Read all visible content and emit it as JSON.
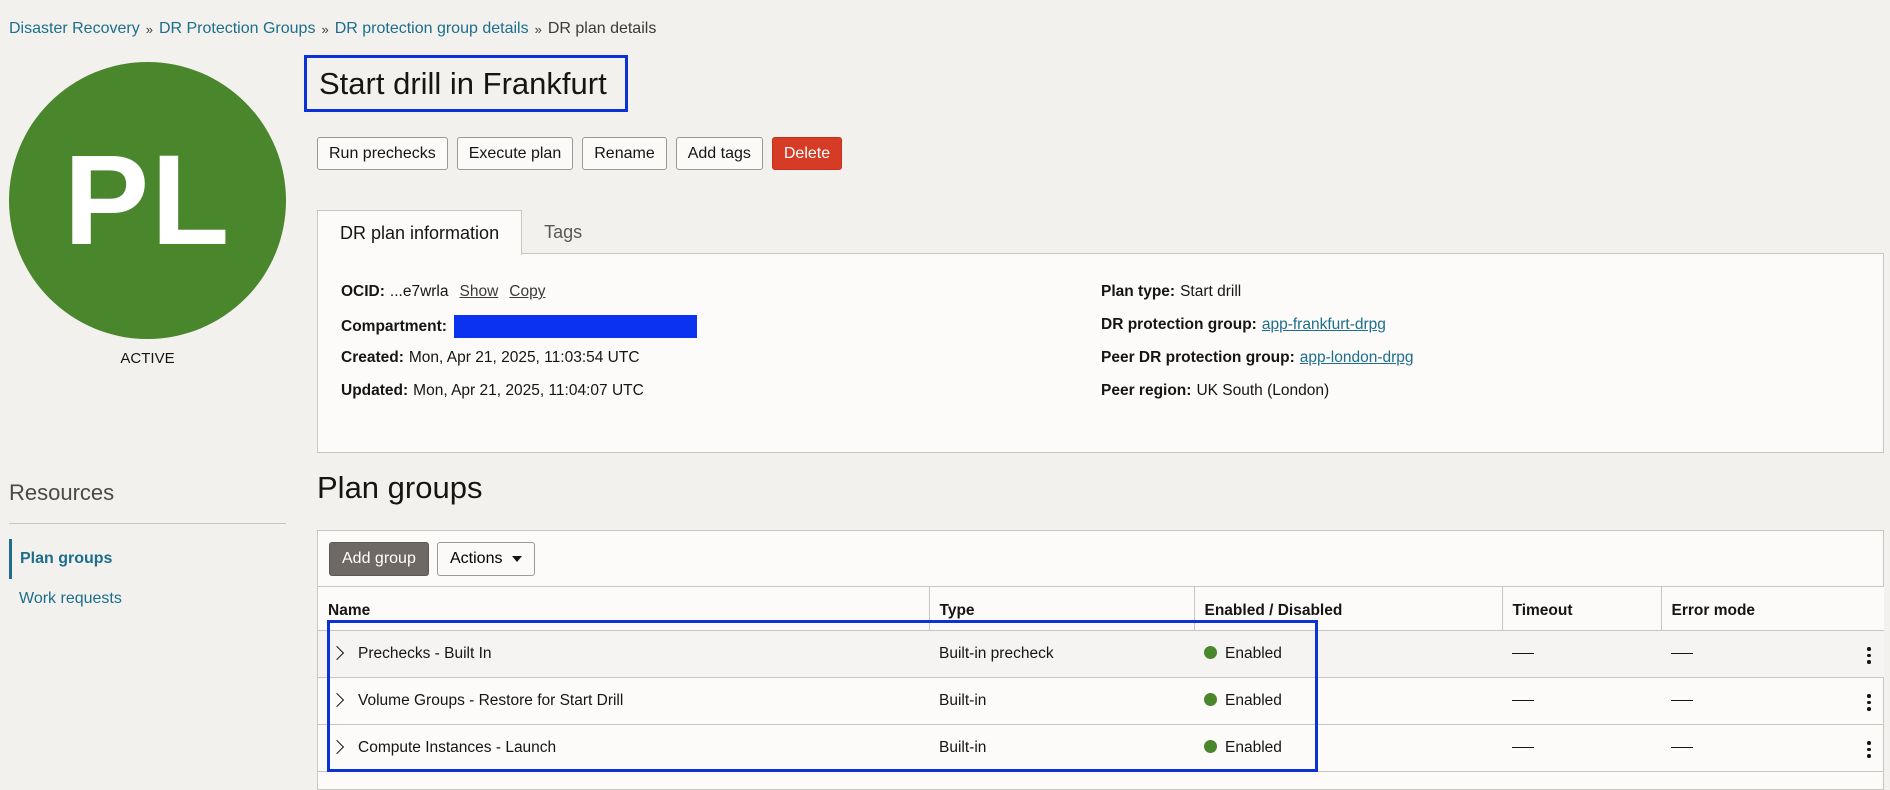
{
  "breadcrumb": {
    "items": [
      "Disaster Recovery",
      "DR Protection Groups",
      "DR protection group details"
    ],
    "current": "DR plan details",
    "separator": "»"
  },
  "avatar": {
    "initials": "PL",
    "status": "ACTIVE",
    "color": "#4a862b"
  },
  "page": {
    "title": "Start drill in Frankfurt"
  },
  "actions": {
    "run_prechecks": "Run prechecks",
    "execute_plan": "Execute plan",
    "rename": "Rename",
    "add_tags": "Add tags",
    "delete": "Delete"
  },
  "tabs": [
    {
      "label": "DR plan information",
      "active": true
    },
    {
      "label": "Tags",
      "active": false
    }
  ],
  "info": {
    "ocid_label": "OCID:",
    "ocid_value": "...e7wrla",
    "ocid_show": "Show",
    "ocid_copy": "Copy",
    "compartment_label": "Compartment:",
    "created_label": "Created:",
    "created_value": "Mon, Apr 21, 2025, 11:03:54 UTC",
    "updated_label": "Updated:",
    "updated_value": "Mon, Apr 21, 2025, 11:04:07 UTC",
    "plan_type_label": "Plan type:",
    "plan_type_value": "Start drill",
    "drpg_label": "DR protection group:",
    "drpg_value": "app-frankfurt-drpg",
    "peer_drpg_label": "Peer DR protection group:",
    "peer_drpg_value": "app-london-drpg",
    "peer_region_label": "Peer region:",
    "peer_region_value": "UK South (London)"
  },
  "resources": {
    "heading": "Resources",
    "items": [
      {
        "label": "Plan groups",
        "active": true
      },
      {
        "label": "Work requests",
        "active": false
      }
    ]
  },
  "plan_groups": {
    "heading": "Plan groups",
    "add_group": "Add group",
    "actions": "Actions",
    "columns": [
      "Name",
      "Type",
      "Enabled / Disabled",
      "Timeout",
      "Error mode"
    ],
    "rows": [
      {
        "name": "Prechecks - Built In",
        "type": "Built-in precheck",
        "status": "Enabled"
      },
      {
        "name": "Volume Groups - Restore for Start Drill",
        "type": "Built-in",
        "status": "Enabled"
      },
      {
        "name": "Compute Instances - Launch",
        "type": "Built-in",
        "status": "Enabled"
      }
    ]
  },
  "colors": {
    "accent": "#1d6e8c",
    "danger": "#d63b25",
    "highlight": "#0b32d4",
    "enabled": "#4a862b"
  }
}
